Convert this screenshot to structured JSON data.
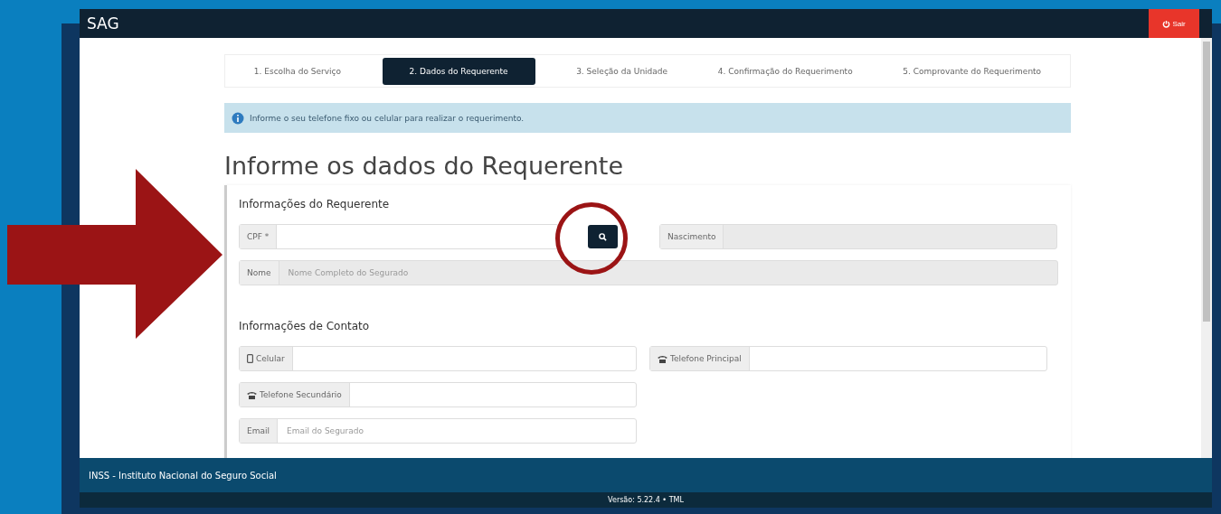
{
  "header": {
    "title": "SAG",
    "logout_button": "Sair"
  },
  "steps": [
    {
      "label": "1. Escolha do Serviço",
      "selected": false
    },
    {
      "label": "2. Dados do Requerente",
      "selected": true
    },
    {
      "label": "3. Seleção da Unidade",
      "selected": false
    },
    {
      "label": "4. Confirmação do Requerimento",
      "selected": false
    },
    {
      "label": "5. Comprovante do Requerimento",
      "selected": false
    }
  ],
  "alert": "Informe o seu telefone fixo ou celular para realizar o requerimento.",
  "page_title": "Informe os dados do Requerente",
  "sections": [
    {
      "heading": "Informações do Requerente",
      "rows": [
        [
          {
            "label": "CPF *",
            "disabled": false,
            "kind": "search"
          },
          {
            "label": "Nascimento",
            "disabled": true,
            "kind": "plain"
          }
        ],
        [
          {
            "label": "Nome",
            "placeholder": "Nome Completo do Segurado",
            "disabled": true,
            "kind": "wide"
          }
        ]
      ]
    },
    {
      "heading": "Informações de Contato",
      "rows": [
        [
          {
            "label": "Celular",
            "kind": "mobile",
            "disabled": false
          },
          {
            "label": "Telefone Principal",
            "kind": "phone",
            "disabled": false
          }
        ],
        [
          {
            "label": "Telefone Secundário",
            "kind": "phone",
            "disabled": false
          }
        ],
        [
          {
            "label": "Email",
            "placeholder": "Email do Segurado",
            "disabled": false,
            "kind": "plain"
          }
        ]
      ]
    }
  ],
  "footer": {
    "org": "INSS - Instituto Nacional do Seguro Social",
    "version": "Versão: 5.22.4 • TML"
  }
}
